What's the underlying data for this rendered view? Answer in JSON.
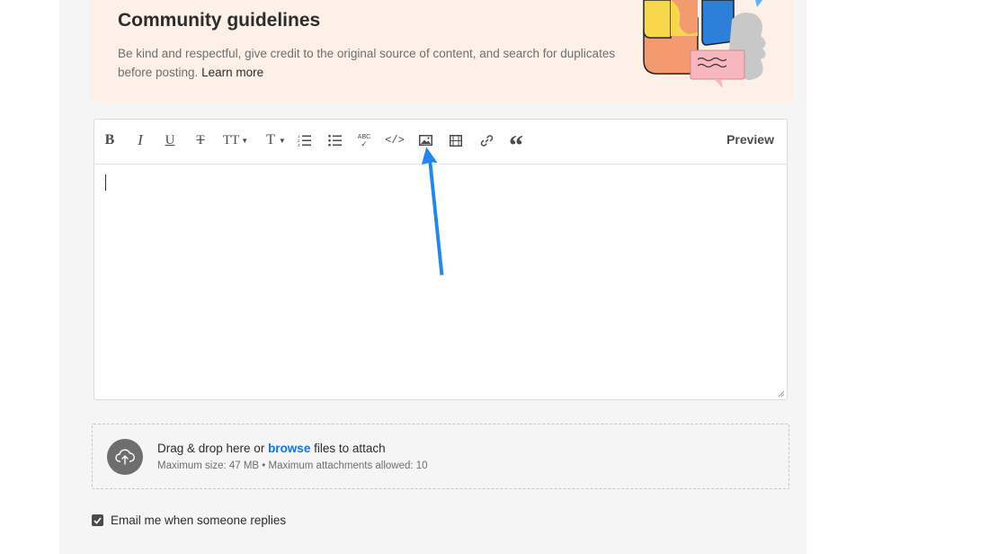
{
  "guidelines": {
    "title": "Community guidelines",
    "text": "Be kind and respectful, give credit to the original source of content, and search for duplicates before posting.",
    "link": "Learn more"
  },
  "toolbar": {
    "buttons": [
      {
        "name": "bold-icon",
        "glyph": "B"
      },
      {
        "name": "italic-icon",
        "glyph": "I"
      },
      {
        "name": "underline-icon",
        "glyph": "U"
      },
      {
        "name": "strikethrough-icon",
        "glyph": "T"
      },
      {
        "name": "font-size-icon",
        "glyph": "TT"
      },
      {
        "name": "text-format-icon",
        "glyph": "T"
      },
      {
        "name": "numbered-list-icon"
      },
      {
        "name": "bullet-list-icon"
      },
      {
        "name": "spellcheck-icon",
        "glyph": "ABC"
      },
      {
        "name": "code-icon",
        "glyph": "</>"
      },
      {
        "name": "image-icon"
      },
      {
        "name": "video-icon"
      },
      {
        "name": "link-icon"
      },
      {
        "name": "quote-icon",
        "glyph": "“"
      }
    ],
    "preview_label": "Preview"
  },
  "dropzone": {
    "text_before": "Drag & drop here or ",
    "link": "browse",
    "text_after": " files to attach",
    "limits": "Maximum size: 47 MB • Maximum attachments allowed: 10"
  },
  "email_option": {
    "label": "Email me when someone replies",
    "checked": true
  },
  "colors": {
    "accent": "#1473e6",
    "banner": "#fdf1e7",
    "annotation_arrow": "#1e88f0"
  }
}
